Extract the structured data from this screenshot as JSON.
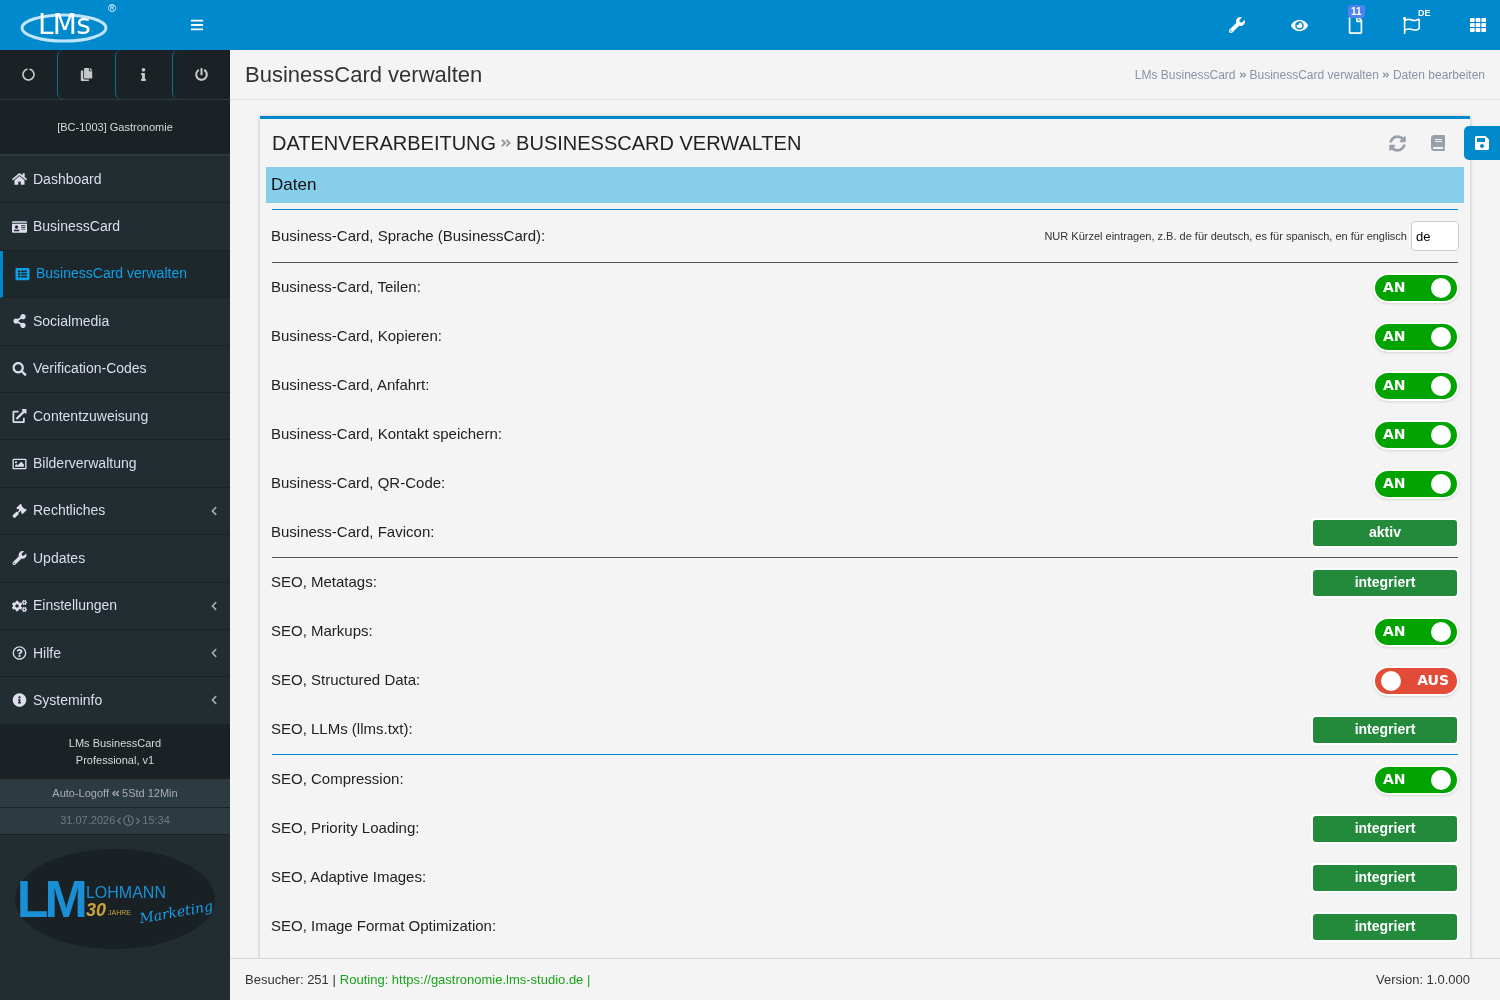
{
  "header": {
    "logo": "LMs",
    "registered": "®",
    "notifications_badge": "11",
    "language_badge": "DE"
  },
  "sidebar": {
    "account": "[BC-1003] Gastronomie",
    "items": [
      {
        "label": "Dashboard",
        "selected": false,
        "expandable": false
      },
      {
        "label": "BusinessCard",
        "selected": false,
        "expandable": false
      },
      {
        "label": "BusinessCard verwalten",
        "selected": true,
        "expandable": false
      },
      {
        "label": "Socialmedia",
        "selected": false,
        "expandable": false
      },
      {
        "label": "Verification-Codes",
        "selected": false,
        "expandable": false
      },
      {
        "label": "Contentzuweisung",
        "selected": false,
        "expandable": false
      },
      {
        "label": "Bilderverwaltung",
        "selected": false,
        "expandable": false
      },
      {
        "label": "Rechtliches",
        "selected": false,
        "expandable": true
      },
      {
        "label": "Updates",
        "selected": false,
        "expandable": false
      },
      {
        "label": "Einstellungen",
        "selected": false,
        "expandable": true
      },
      {
        "label": "Hilfe",
        "selected": false,
        "expandable": true
      },
      {
        "label": "Systeminfo",
        "selected": false,
        "expandable": true
      }
    ],
    "product_lines": [
      "LMs BusinessCard",
      "Professional, v1"
    ],
    "auto_logoff": {
      "label": "Auto-Logoff",
      "value": "5Std 12Min"
    },
    "datetime": {
      "date": "31.07.2026",
      "time": "15:34"
    },
    "brand": {
      "letters": "LM",
      "name": "LOHMANN",
      "years": "30",
      "years_word": "JAHRE",
      "tagline": "Marketing"
    }
  },
  "page": {
    "title": "BusinessCard verwalten",
    "breadcrumbs": [
      "LMs BusinessCard",
      "BusinessCard verwalten",
      "Daten bearbeiten"
    ]
  },
  "panel": {
    "title_parts": [
      "DATENVERARBEITUNG",
      "BUSINESSCARD VERWALTEN"
    ],
    "section": "Daten",
    "groups": [
      {
        "rows": [
          {
            "kind": "input",
            "label": "Business-Card, Sprache (BusinessCard):",
            "hint": "NUR Kürzel eintragen, z.B. de für deutsch, es für spanisch, en für englisch",
            "value": "de"
          }
        ]
      },
      {
        "rows": [
          {
            "kind": "toggle",
            "label": "Business-Card, Teilen:",
            "on": true,
            "state_text": "AN"
          },
          {
            "kind": "toggle",
            "label": "Business-Card, Kopieren:",
            "on": true,
            "state_text": "AN"
          },
          {
            "kind": "toggle",
            "label": "Business-Card, Anfahrt:",
            "on": true,
            "state_text": "AN"
          },
          {
            "kind": "toggle",
            "label": "Business-Card, Kontakt speichern:",
            "on": true,
            "state_text": "AN"
          },
          {
            "kind": "toggle",
            "label": "Business-Card, QR-Code:",
            "on": true,
            "state_text": "AN"
          },
          {
            "kind": "status",
            "label": "Business-Card, Favicon:",
            "status": "aktiv"
          }
        ]
      },
      {
        "rows": [
          {
            "kind": "status",
            "label": "SEO, Metatags:",
            "status": "integriert"
          },
          {
            "kind": "toggle",
            "label": "SEO, Markups:",
            "on": true,
            "state_text": "AN"
          },
          {
            "kind": "toggle",
            "label": "SEO, Structured Data:",
            "on": false,
            "state_text": "AUS"
          },
          {
            "kind": "status",
            "label": "SEO, LLMs (llms.txt):",
            "status": "integriert"
          }
        ]
      },
      {
        "rows": [
          {
            "kind": "toggle",
            "label": "SEO, Compression:",
            "on": true,
            "state_text": "AN"
          },
          {
            "kind": "status",
            "label": "SEO, Priority Loading:",
            "status": "integriert"
          },
          {
            "kind": "status",
            "label": "SEO, Adaptive Images:",
            "status": "integriert"
          },
          {
            "kind": "status",
            "label": "SEO, Image Format Optimization:",
            "status": "integriert"
          }
        ]
      }
    ]
  },
  "footer": {
    "visitors": "Besucher: 251 |",
    "routing": "Routing: https://gastronomie.lms-studio.de |",
    "version": "Version: 1.0.000"
  }
}
